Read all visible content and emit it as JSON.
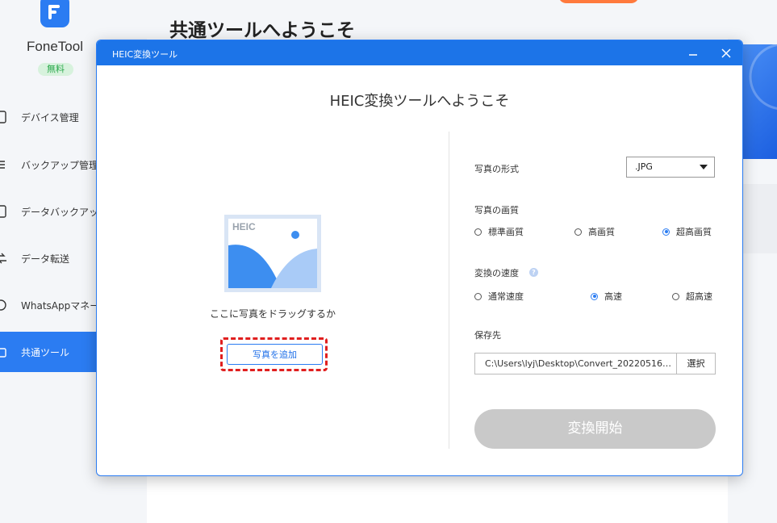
{
  "app": {
    "name": "FoneTool",
    "plan_badge": "無料",
    "brand_color": "#2b7cf2"
  },
  "sidebar": {
    "items": [
      {
        "label": "デバイス管理",
        "icon": "phone-icon",
        "active": false
      },
      {
        "label": "バックアップ管理",
        "icon": "list-icon",
        "active": false
      },
      {
        "label": "データバックアップ",
        "icon": "phone-backup-icon",
        "active": false
      },
      {
        "label": "データ転送",
        "icon": "transfer-icon",
        "active": false
      },
      {
        "label": "WhatsAppマネージャー",
        "icon": "whatsapp-icon",
        "active": false
      },
      {
        "label": "共通ツール",
        "icon": "toolbox-icon",
        "active": true
      }
    ]
  },
  "main": {
    "title": "共通ツールへようこそ"
  },
  "dialog": {
    "title": "HEIC変換ツール",
    "heading": "HEIC変換ツールへようこそ",
    "left": {
      "illustration_label": "HEIC",
      "drop_text": "ここに写真をドラッグするか",
      "add_button": "写真を追加"
    },
    "format": {
      "label": "写真の形式",
      "selected": ".JPG"
    },
    "quality": {
      "label": "写真の画質",
      "options": [
        "標準画質",
        "高画質",
        "超高画質"
      ],
      "selected_index": 2
    },
    "speed": {
      "label": "変換の速度",
      "help": "?",
      "options": [
        "通常速度",
        "高速",
        "超高速"
      ],
      "selected_index": 1
    },
    "save": {
      "label": "保存先",
      "path": "C:\\Users\\lyj\\Desktop\\Convert_202205161...",
      "browse_button": "選択"
    },
    "start_button": "変換開始"
  }
}
